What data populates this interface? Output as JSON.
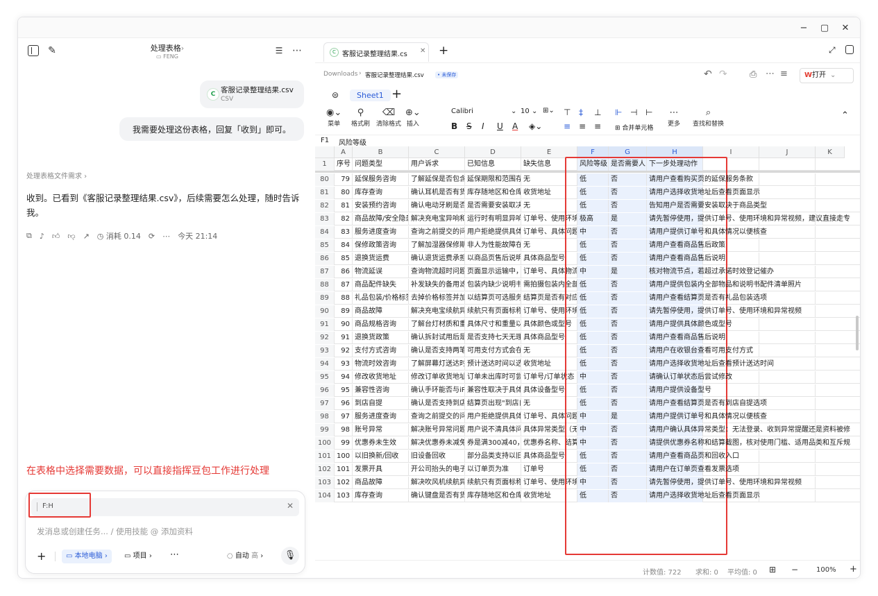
{
  "window": {
    "min": "−",
    "max": "▢",
    "close": "✕"
  },
  "chat": {
    "title": "处理表格",
    "title_chevron": "›",
    "subtitle": "FENG",
    "file_name": "客服记录整理结果.csv",
    "file_type": "CSV",
    "file_icon": "C",
    "user_message": "我需要处理这份表格，回复「收到」即可。",
    "reasoning_label": "处理表格文件需求 ›",
    "reply": "收到。已看到《客服记录整理结果.csv》，后续需要怎么处理，随时告诉我。",
    "cost": "消耗 0.14",
    "time": "今天 21:14",
    "annotation": "在表格中选择需要数据，可以直接指挥豆包工作进行处理",
    "ref_tag": "F:H",
    "input_placeholder": "发消息或创建任务... / 使用技能 @ 添加资料",
    "local_btn": "本地电脑",
    "project_btn": "项目",
    "auto_label": "自动",
    "auto_level": "高"
  },
  "sheet": {
    "tab_label": "客服记录整理结果.cs",
    "breadcrumb_root": "Downloads",
    "breadcrumb_sep": "›",
    "breadcrumb_file": "客服记录整理结果.csv",
    "unsaved": "• 未保存",
    "open_btn": "打开",
    "sheet_tab": "Sheet1",
    "toolbar": {
      "menu": "菜单",
      "format_painter": "格式刷",
      "clear_format": "清除格式",
      "insert": "插入",
      "font": "Calibri",
      "size": "10",
      "merge": "合并单元格",
      "more": "更多",
      "find": "查找和替换",
      "bold": "B",
      "strike": "S",
      "italic": "I",
      "underline": "U",
      "fontcolor": "A"
    },
    "cell_ref": "F1",
    "cell_value": "风险等级",
    "columns": [
      "A",
      "B",
      "C",
      "D",
      "E",
      "F",
      "G",
      "H",
      "I",
      "J",
      "K"
    ],
    "header_row": {
      "num": "1",
      "cells": [
        "序号",
        "问题类型",
        "用户诉求",
        "已知信息",
        "缺失信息",
        "风险等级",
        "是否需要人",
        "下一步处理动作",
        "",
        ""
      ]
    },
    "rows": [
      {
        "num": "80",
        "cells": [
          "79",
          "延保服务咨询",
          "了解延保是否包含",
          "延保期限和范围存",
          "无",
          "低",
          "否",
          "请用户查看购买页的延保服务条款",
          "",
          ""
        ]
      },
      {
        "num": "81",
        "cells": [
          "80",
          "库存查询",
          "确认耳机是否有货",
          "库存随地区和仓库",
          "收货地址",
          "低",
          "否",
          "请用户选择收货地址后查看页面显示",
          "",
          ""
        ]
      },
      {
        "num": "82",
        "cells": [
          "81",
          "安装预约咨询",
          "确认电动牙刷是否",
          "是否需要安装取决",
          "无",
          "低",
          "否",
          "告知用户是否需要安装取决于商品类型",
          "",
          ""
        ]
      },
      {
        "num": "83",
        "cells": [
          "82",
          "商品故障/安全隐患",
          "解决充电宝异响和",
          "运行时有明显异响",
          "订单号、使用环境",
          "极高",
          "是",
          "请先暂停使用，提供订单号、使用环境和异常视频，建议直接走专",
          "",
          ""
        ]
      },
      {
        "num": "84",
        "cells": [
          "83",
          "服务进度查询",
          "查询之前提交的问",
          "用户拒绝提供具体",
          "订单号、具体问题",
          "中",
          "否",
          "请用户提供订单号和具体情况以便核查",
          "",
          ""
        ]
      },
      {
        "num": "85",
        "cells": [
          "84",
          "保修政策咨询",
          "了解加湿器保修期",
          "非人为性能故障在",
          "无",
          "低",
          "否",
          "请用户查看商品售后政策",
          "",
          ""
        ]
      },
      {
        "num": "86",
        "cells": [
          "85",
          "退换货运费",
          "确认退货运费承担",
          "以商品页售后说明",
          "具体商品型号",
          "低",
          "否",
          "请用户查看商品售后说明",
          "",
          ""
        ]
      },
      {
        "num": "87",
        "cells": [
          "86",
          "物流延误",
          "查询物流超时问题",
          "页面显示运输中，",
          "订单号、具体物流",
          "中",
          "是",
          "核对物流节点，若超过承诺时效登记催办",
          "",
          ""
        ]
      },
      {
        "num": "88",
        "cells": [
          "87",
          "商品配件缺失",
          "补发缺失的备用滤",
          "包装内缺少说明书",
          "需拍摄包装内全部",
          "低",
          "否",
          "请用户提供包装内全部物品和说明书配件清单照片",
          "",
          ""
        ]
      },
      {
        "num": "89",
        "cells": [
          "88",
          "礼品包装/价格标签",
          "去掉价格标签并加",
          "以结算页可选服务",
          "结算页是否有对应",
          "低",
          "否",
          "请用户查看结算页是否有礼品包装选项",
          "",
          ""
        ]
      },
      {
        "num": "90",
        "cells": [
          "89",
          "商品故障",
          "解决充电宝续航异",
          "续航只有页面标称",
          "订单号、使用环境",
          "低",
          "否",
          "请先暂停使用，提供订单号、使用环境和异常视频",
          "",
          ""
        ]
      },
      {
        "num": "91",
        "cells": [
          "90",
          "商品规格咨询",
          "了解台灯材质和重",
          "具体尺寸和重量以",
          "具体颜色或型号",
          "低",
          "否",
          "请用户提供具体颜色或型号",
          "",
          ""
        ]
      },
      {
        "num": "92",
        "cells": [
          "91",
          "退换货政策",
          "确认拆封试用后是",
          "是否支持七天无理",
          "具体商品型号",
          "低",
          "否",
          "请用户查看商品售后说明",
          "",
          ""
        ]
      },
      {
        "num": "93",
        "cells": [
          "92",
          "支付方式咨询",
          "确认是否支持两笔",
          "可用支付方式会在",
          "无",
          "低",
          "否",
          "请用户在收银台查看可用支付方式",
          "",
          ""
        ]
      },
      {
        "num": "94",
        "cells": [
          "93",
          "物流时效咨询",
          "了解屏幕灯送达时",
          "预计送达时间以选",
          "收货地址",
          "低",
          "否",
          "请用户选择收货地址后查看预计送达时间",
          "",
          ""
        ]
      },
      {
        "num": "95",
        "cells": [
          "94",
          "修改收货地址",
          "修改订单收货地址",
          "订单未出库时可尝",
          "订单号/订单状态",
          "中",
          "否",
          "请确认订单状态后尝试修改",
          "",
          ""
        ]
      },
      {
        "num": "96",
        "cells": [
          "95",
          "兼容性咨询",
          "确认手环能否与iP",
          "兼容性取决于具体",
          "具体设备型号",
          "低",
          "否",
          "请用户提供设备型号",
          "",
          ""
        ]
      },
      {
        "num": "97",
        "cells": [
          "96",
          "到店自提",
          "确认是否支持到店",
          "结算页出现\"到店自",
          "无",
          "低",
          "否",
          "请用户查看结算页是否有到店自提选项",
          "",
          ""
        ]
      },
      {
        "num": "98",
        "cells": [
          "97",
          "服务进度查询",
          "查询之前提交的问",
          "用户拒绝提供具体",
          "订单号、具体问题",
          "中",
          "是",
          "请用户提供订单号和具体情况以便核查",
          "",
          ""
        ]
      },
      {
        "num": "99",
        "cells": [
          "98",
          "账号异常",
          "解决账号异常问题",
          "用户说不清具体问",
          "具体异常类型（无",
          "中",
          "否",
          "请用户确认具体异常类型：无法登录、收到异常提醒还是资料被修",
          "",
          ""
        ]
      },
      {
        "num": "100",
        "cells": [
          "99",
          "优惠券未生效",
          "解决优惠券未减免",
          "券是满300减40，",
          "优惠券名称、结算",
          "中",
          "否",
          "请提供优惠券名称和结算截图，核对使用门槛、适用品类和互斥规",
          "",
          ""
        ]
      },
      {
        "num": "101",
        "cells": [
          "100",
          "以旧换新/回收",
          "旧设备回收",
          "部分品类支持以旧",
          "具体商品型号",
          "低",
          "否",
          "请用户查看商品页和回收入口",
          "",
          ""
        ]
      },
      {
        "num": "102",
        "cells": [
          "101",
          "发票开具",
          "开公司抬头的电子",
          "以订单页为准",
          "订单号",
          "低",
          "否",
          "请用户在订单页查看发票选项",
          "",
          ""
        ]
      },
      {
        "num": "103",
        "cells": [
          "102",
          "商品故障",
          "解决吹风机续航异",
          "续航只有页面标称",
          "订单号、使用环境",
          "中",
          "否",
          "请先暂停使用，提供订单号、使用环境和异常视频",
          "",
          ""
        ]
      },
      {
        "num": "104",
        "cells": [
          "103",
          "库存查询",
          "确认键盘是否有货",
          "库存随地区和仓库",
          "收货地址",
          "低",
          "否",
          "请用户选择收货地址后查看页面显示",
          "",
          ""
        ]
      }
    ],
    "status": {
      "count": "计数值: 722",
      "sum": "求和: 0",
      "avg": "平均值: 0",
      "zoom": "100%",
      "minus": "−",
      "plus": "+"
    }
  },
  "colors": {
    "accent": "#2a5bd7",
    "annotation_red": "#e53935",
    "brand_red": "#e33b2f"
  }
}
